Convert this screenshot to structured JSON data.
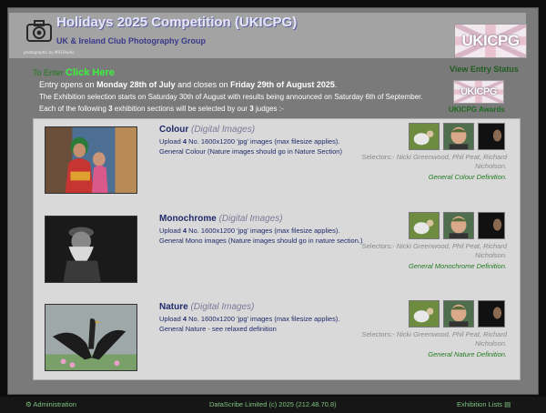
{
  "header": {
    "title": "Holidays 2025 Competition (UKICPG)",
    "subtitle": "UK & Ireland Club Photography Group",
    "logo_caption": "photographic by MR1Studio",
    "brand_badge": "UKICPG",
    "view_entry_status": "View Entry Status",
    "awards_badge": "UKICPG",
    "awards_label": "UKICPG Awards"
  },
  "intro": {
    "to_enter": "To Enter",
    "click_here": "Click Here",
    "entry_prefix": "Entry opens on",
    "entry_open": "Monday 28th of July",
    "entry_mid": "and closes on",
    "entry_close": "Friday 29th of August 2025",
    "entry_suffix": ".",
    "exhibition_line": "The Exhibition selection starts on Saturday 30th of August with results being announced on Saturday 6th of September.",
    "judges_prefix": "Each of the following",
    "sections_count": "3",
    "judges_mid": "exhibition sections will be selected by our",
    "judges_count": "3",
    "judges_suffix": "judges :-"
  },
  "sections": [
    {
      "title": "Colour",
      "type": "(Digital Images)",
      "upload_prefix": "Upload",
      "upload_count": "4",
      "upload_suffix": "No. 1600x1200 'jpg' images (max filesize applies).",
      "description": "General Colour (Nature images should go in Nature Section)",
      "selectors_label": "Selectors:-",
      "selectors": "Nicki Greenwood, Phil Peat, Richard Nicholson.",
      "definition": "General Colour Definition."
    },
    {
      "title": "Monochrome",
      "type": "(Digital Images)",
      "upload_prefix": "Upload",
      "upload_count": "4",
      "upload_suffix": "No. 1600x1200 'jpg' images (max filesize applies).",
      "description": "General Mono images (Nature images should go in nature section.)",
      "selectors_label": "Selectors:-",
      "selectors": "Nicki Greenwood, Phil Peat, Richard Nicholson.",
      "definition": "General Monochrome Definition."
    },
    {
      "title": "Nature",
      "type": "(Digital Images)",
      "upload_prefix": "Upload",
      "upload_count": "4",
      "upload_suffix": "No. 1600x1200 'jpg' images (max filesize applies).",
      "description": "General Nature - see relaxed definition",
      "selectors_label": "Selectors:-",
      "selectors": "Nicki Greenwood, Phil Peat, Richard Nicholson.",
      "definition": "General Nature Definition."
    }
  ],
  "footer": {
    "admin": "Administration",
    "copyright": "DataScribe Limited (c) 2025 (212.48.70.8)",
    "lists": "Exhibition Lists"
  },
  "colors": {
    "frame": "#7a7a7a",
    "panel": "#d9d9d9",
    "title_blue": "#1f2a6b",
    "link_green": "#1e7a1e",
    "click_green": "#3df23d"
  },
  "icons": [
    "camera-icon",
    "gear-icon",
    "list-icon"
  ]
}
